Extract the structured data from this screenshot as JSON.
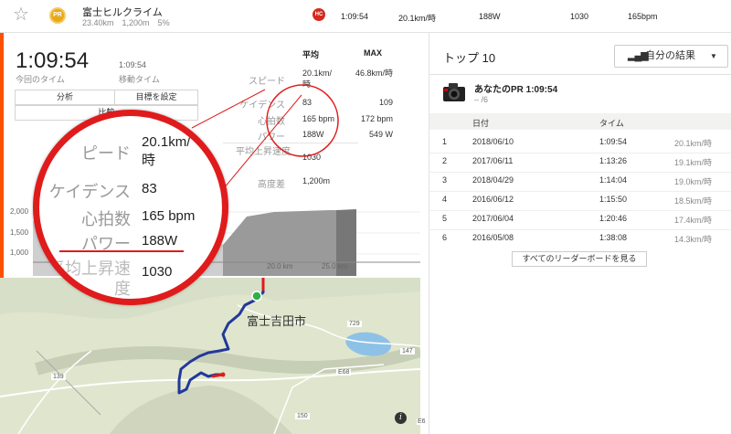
{
  "header": {
    "segment_name": "富士ヒルクライム",
    "distance": "23.40km",
    "elevation": "1,200m",
    "grade": "5%",
    "pr_badge": "PR",
    "hc_badge": "HC",
    "time": "1:09:54",
    "speed": "20.1km/時",
    "power": "188W",
    "vam": "1030",
    "heart_rate": "165bpm"
  },
  "effort": {
    "elapsed_time": "1:09:54",
    "elapsed_label": "今回のタイム",
    "moving_time": "1:09:54",
    "moving_label": "移動タイム",
    "btn_analyze": "分析",
    "btn_set_goal": "目標を設定",
    "btn_compare": "比較"
  },
  "stats": {
    "col_avg": "平均",
    "col_max": "MAX",
    "rows": [
      {
        "label": "スピード",
        "avg": "20.1km/時",
        "max": "46.8km/時"
      },
      {
        "label": "ケイデンス",
        "avg": "83",
        "max": "109"
      },
      {
        "label": "心拍数",
        "avg": "165 bpm",
        "max": "172 bpm"
      },
      {
        "label": "パワー",
        "avg": "188W",
        "max": "549 W"
      },
      {
        "label": "平均上昇速度",
        "avg": "1030",
        "max": ""
      },
      {
        "label": "高度差",
        "avg": "1,200m",
        "max": ""
      }
    ]
  },
  "elevation_chart": {
    "y_ticks": [
      "2,000",
      "1,500",
      "1,000"
    ],
    "x_ticks": [
      "20.0 km",
      "25.0 km"
    ],
    "fill_color": "#cfcfcf"
  },
  "magnifier": {
    "rows": [
      {
        "label": "ピード",
        "value": "20.1km/時"
      },
      {
        "label": "ケイデンス",
        "value": "83"
      },
      {
        "label": "心拍数",
        "value": "165 bpm"
      },
      {
        "label": "パワー",
        "value": "188W"
      },
      {
        "label": "平均上昇速",
        "value": "1030"
      },
      {
        "label": "度",
        "value": ""
      },
      {
        "label": "差",
        "value": "1,20"
      }
    ]
  },
  "map": {
    "city_label": "富士吉田市",
    "road_labels": [
      "139",
      "729",
      "147",
      "E68",
      "150",
      "E6"
    ],
    "info_icon": "info-icon"
  },
  "leaderboard": {
    "title": "トップ 10",
    "filter_label": "自分の結果",
    "my_pr_title": "あなたのPR 1:09:54",
    "my_pr_sub": "– /6",
    "col_date": "日付",
    "col_time": "タイム",
    "rows": [
      {
        "rank": "1",
        "date": "2018/06/10",
        "time": "1:09:54",
        "speed": "20.1km/時"
      },
      {
        "rank": "2",
        "date": "2017/06/11",
        "time": "1:13:26",
        "speed": "19.1km/時"
      },
      {
        "rank": "3",
        "date": "2018/04/29",
        "time": "1:14:04",
        "speed": "19.0km/時"
      },
      {
        "rank": "4",
        "date": "2016/06/12",
        "time": "1:15:50",
        "speed": "18.5km/時"
      },
      {
        "rank": "5",
        "date": "2017/06/04",
        "time": "1:20:46",
        "speed": "17.4km/時"
      },
      {
        "rank": "6",
        "date": "2016/05/08",
        "time": "1:38:08",
        "speed": "14.3km/時"
      }
    ],
    "see_all": "すべてのリーダーボードを見る"
  },
  "colors": {
    "accent": "#fc5200",
    "highlight_red": "#e01b1b",
    "route_blue": "#22389a"
  }
}
